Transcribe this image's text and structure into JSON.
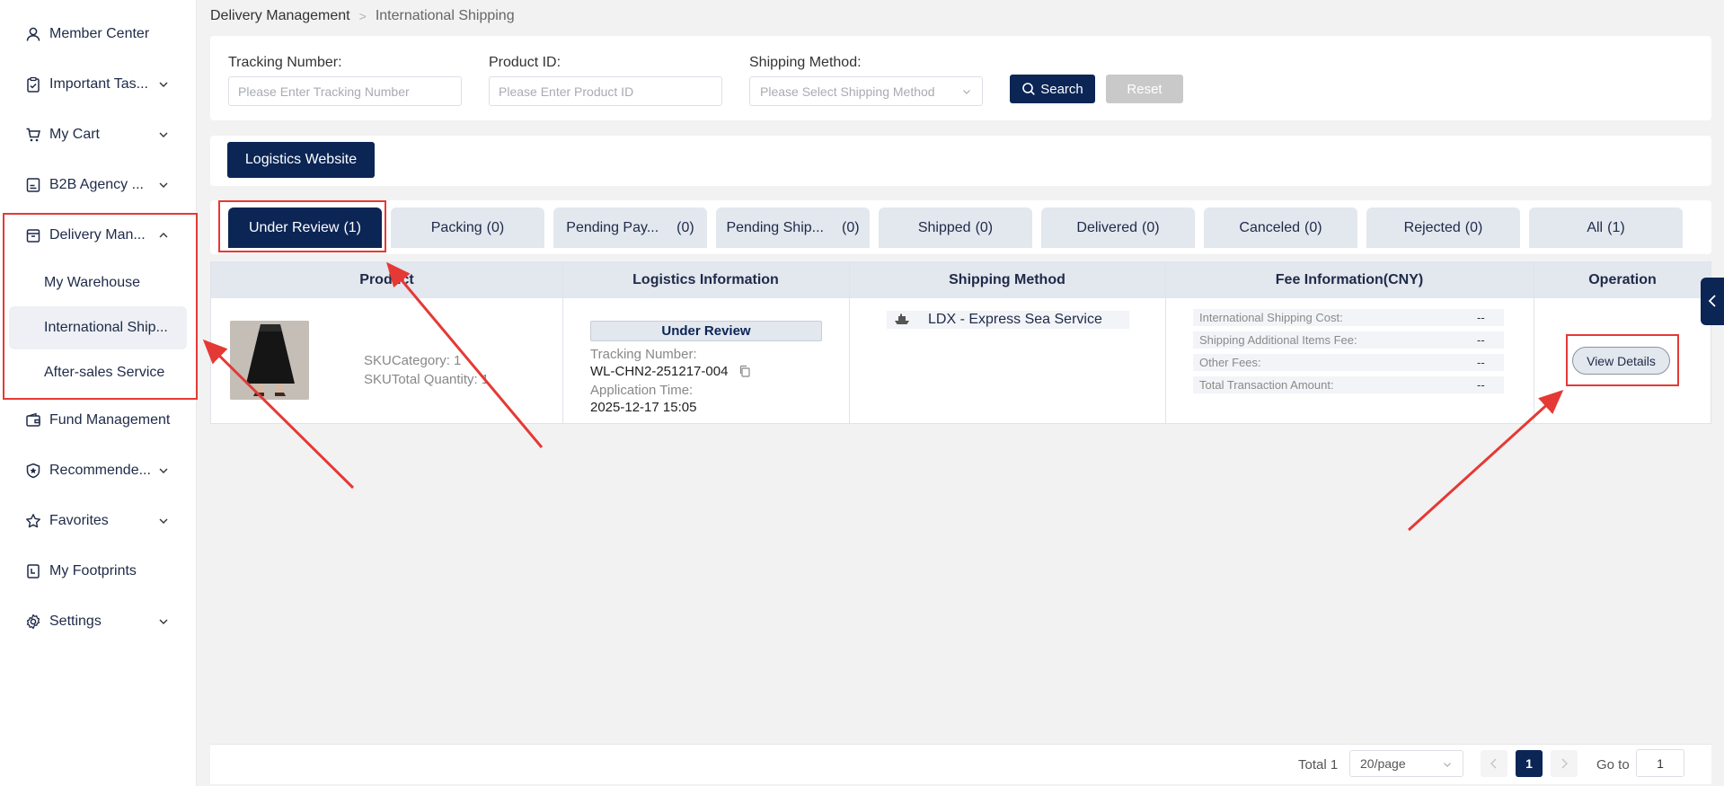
{
  "sidebar": {
    "items": [
      {
        "label": "Member Center",
        "icon": "user-icon"
      },
      {
        "label": "Important Tas...",
        "icon": "clipboard-check-icon"
      },
      {
        "label": "My Cart",
        "icon": "cart-icon"
      },
      {
        "label": "B2B Agency ...",
        "icon": "document-icon"
      },
      {
        "label": "Delivery Man...",
        "icon": "box-icon"
      },
      {
        "label": "Fund Management",
        "icon": "wallet-icon"
      },
      {
        "label": "Recommende...",
        "icon": "shield-star-icon"
      },
      {
        "label": "Favorites",
        "icon": "star-icon"
      },
      {
        "label": "My Footprints",
        "icon": "footprint-icon"
      },
      {
        "label": "Settings",
        "icon": "gear-icon"
      }
    ],
    "sub_items": [
      {
        "label": "My Warehouse"
      },
      {
        "label": "International Ship..."
      },
      {
        "label": "After-sales Service"
      }
    ]
  },
  "breadcrumb": {
    "parent": "Delivery Management",
    "current": "International Shipping"
  },
  "filters": {
    "tracking": {
      "label": "Tracking Number:",
      "placeholder": "Please Enter Tracking Number"
    },
    "product": {
      "label": "Product ID:",
      "placeholder": "Please Enter Product ID"
    },
    "method": {
      "label": "Shipping Method:",
      "placeholder": "Please Select Shipping Method"
    },
    "search_label": "Search",
    "reset_label": "Reset"
  },
  "logistics_button": "Logistics Website",
  "tabs": [
    {
      "name": "Under Review",
      "count": "(1)"
    },
    {
      "name": "Packing",
      "count": "(0)"
    },
    {
      "name": "Pending Pay...",
      "count": "(0)"
    },
    {
      "name": "Pending Ship...",
      "count": "(0)"
    },
    {
      "name": "Shipped",
      "count": "(0)"
    },
    {
      "name": "Delivered",
      "count": "(0)"
    },
    {
      "name": "Canceled",
      "count": "(0)"
    },
    {
      "name": "Rejected",
      "count": "(0)"
    },
    {
      "name": "All",
      "count": "(1)"
    }
  ],
  "table": {
    "headers": [
      "Product",
      "Logistics Information",
      "Shipping Method",
      "Fee Information(CNY)",
      "Operation"
    ],
    "row": {
      "sku_category": "SKUCategory: 1",
      "sku_total": "SKUTotal Quantity: 1",
      "status": "Under Review",
      "tracking_label": "Tracking Number:",
      "tracking_value": "WL-CHN2-251217-004",
      "app_time_label": "Application Time:",
      "app_time_value": "2025-12-17 15:05",
      "shipping_method": "LDX - Express Sea Service",
      "fees": [
        {
          "k": "International Shipping Cost:",
          "v": "--"
        },
        {
          "k": "Shipping Additional Items Fee:",
          "v": "--"
        },
        {
          "k": "Other Fees:",
          "v": "--"
        },
        {
          "k": "Total Transaction Amount:",
          "v": "--"
        }
      ],
      "action": "View Details"
    }
  },
  "pagination": {
    "total": "Total 1",
    "page_size": "20/page",
    "current_page": "1",
    "goto_label": "Go to",
    "goto_value": "1"
  },
  "colors": {
    "primary": "#0b2555",
    "annotation": "#e53935",
    "tab_bg": "#e3e7ee"
  }
}
